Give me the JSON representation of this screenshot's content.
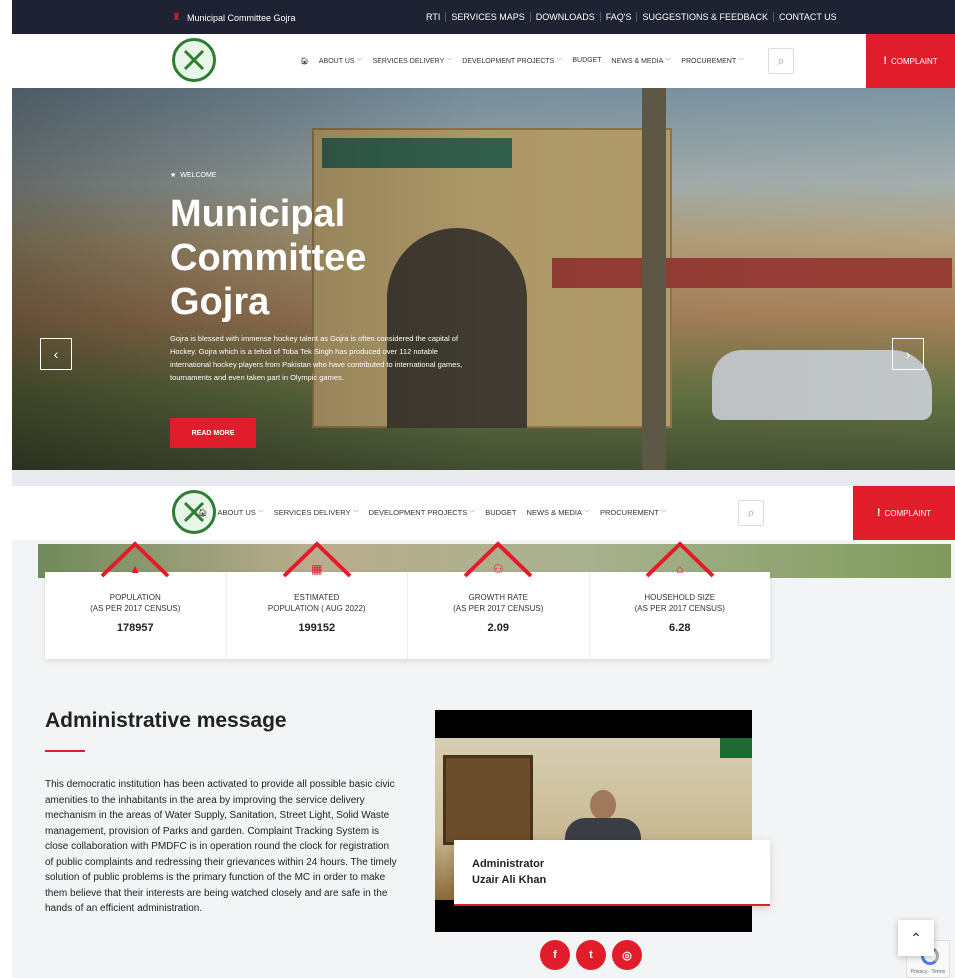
{
  "topbar": {
    "brand": "Municipal Committee Gojra",
    "links": [
      "RTI",
      "SERVICES MAPS",
      "DOWNLOADS",
      "FAQ'S",
      "SUGGESTIONS & FEEDBACK",
      "CONTACT US"
    ]
  },
  "nav": {
    "home_icon": "home-icon",
    "items": [
      "ABOUT US",
      "SERVICES DELIVERY",
      "DEVELOPMENT PROJECTS",
      "BUDGET",
      "NEWS & MEDIA",
      "PROCUREMENT"
    ],
    "complaint": "COMPLAINT"
  },
  "hero": {
    "welcome": "WELCOME",
    "title": "Municipal Committee Gojra",
    "description": "Gojra is blessed with immense hockey talent as Gojra is often considered the capital of Hockey. Gojra which is a tehsil of Toba Tek Singh has produced over 112 notable international hockey players from Pakistan who have contributed to international games, tournaments and even taken part in Olympic games.",
    "read_more": "READ MORE"
  },
  "stats": [
    {
      "label_line1": "POPULATION",
      "label_line2": "(AS PER 2017 CENSUS)",
      "value": "178957",
      "icon": "chart-icon"
    },
    {
      "label_line1": "ESTIMATED",
      "label_line2": "POPULATION ( AUG 2022)",
      "value": "199152",
      "icon": "building-icon"
    },
    {
      "label_line1": "GROWTH RATE",
      "label_line2": "(AS PER 2017 CENSUS)",
      "value": "2.09",
      "icon": "people-icon"
    },
    {
      "label_line1": "HOUSEHOLD SIZE",
      "label_line2": "(AS PER 2017 CENSUS)",
      "value": "6.28",
      "icon": "house-icon"
    }
  ],
  "admin": {
    "title": "Administrative message",
    "message": "This democratic institution has been activated to provide all possible basic civic amenities to the inhabitants in the area by improving the service delivery mechanism in the areas of Water Supply, Sanitation, Street Light, Solid Waste management, provision of Parks and garden. Complaint Tracking System is close collaboration with PMDFC is in operation round the clock for registration of public complaints and redressing their grievances within 24 hours. The timely solution of public problems is the primary function of the MC in order to make them believe that their interests are being watched closely and are safe in the hands of an efficient administration.",
    "role": "Administrator",
    "name": "Uzair Ali Khan"
  },
  "socials": {
    "facebook": "f",
    "twitter": "t",
    "instagram": "◎"
  },
  "colors": {
    "accent": "#e11d2b",
    "topbar": "#1f2233"
  }
}
